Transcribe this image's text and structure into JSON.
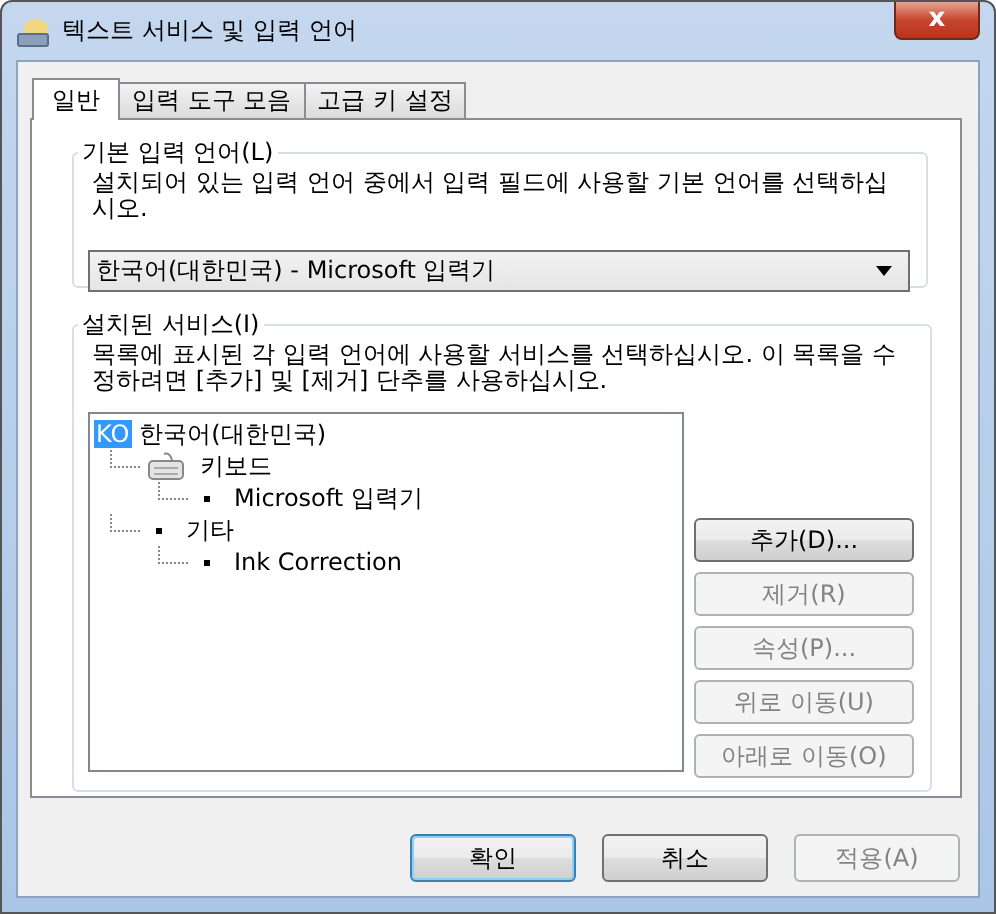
{
  "window": {
    "title": "텍스트 서비스 및 입력 언어",
    "close": "x"
  },
  "tabs": [
    {
      "label": "일반",
      "selected": true
    },
    {
      "label": "입력 도구 모음",
      "selected": false
    },
    {
      "label": "고급 키 설정",
      "selected": false
    }
  ],
  "default_language": {
    "legend": "기본 입력 언어(L)",
    "description": "설치되어 있는 입력 언어 중에서 입력 필드에 사용할 기본 언어를 선택하십시오.",
    "value": "한국어(대한민국) - Microsoft 입력기"
  },
  "installed_services": {
    "legend": "설치된 서비스(I)",
    "description": "목록에 표시된 각 입력 언어에 사용할 서비스를 선택하십시오. 이 목록을 수정하려면 [추가] 및 [제거] 단추를 사용하십시오.",
    "tree": [
      {
        "kind": "language",
        "badge": "KO",
        "label": "한국어(대한민국)",
        "selected": true,
        "children": [
          {
            "kind": "keyboard",
            "label": "키보드",
            "children": [
              {
                "kind": "bullet",
                "label": "Microsoft 입력기"
              }
            ]
          },
          {
            "kind": "bullet",
            "label": "기타",
            "children": [
              {
                "kind": "bullet",
                "label": "Ink Correction"
              }
            ]
          }
        ]
      }
    ],
    "buttons": [
      {
        "label": "추가(D)...",
        "disabled": false
      },
      {
        "label": "제거(R)",
        "disabled": true
      },
      {
        "label": "속성(P)...",
        "disabled": true
      },
      {
        "label": "위로 이동(U)",
        "disabled": true
      },
      {
        "label": "아래로 이동(O)",
        "disabled": true
      }
    ]
  },
  "footer_buttons": [
    {
      "label": "확인",
      "disabled": false,
      "default": true
    },
    {
      "label": "취소",
      "disabled": false,
      "default": false
    },
    {
      "label": "적용(A)",
      "disabled": true,
      "default": false
    }
  ]
}
